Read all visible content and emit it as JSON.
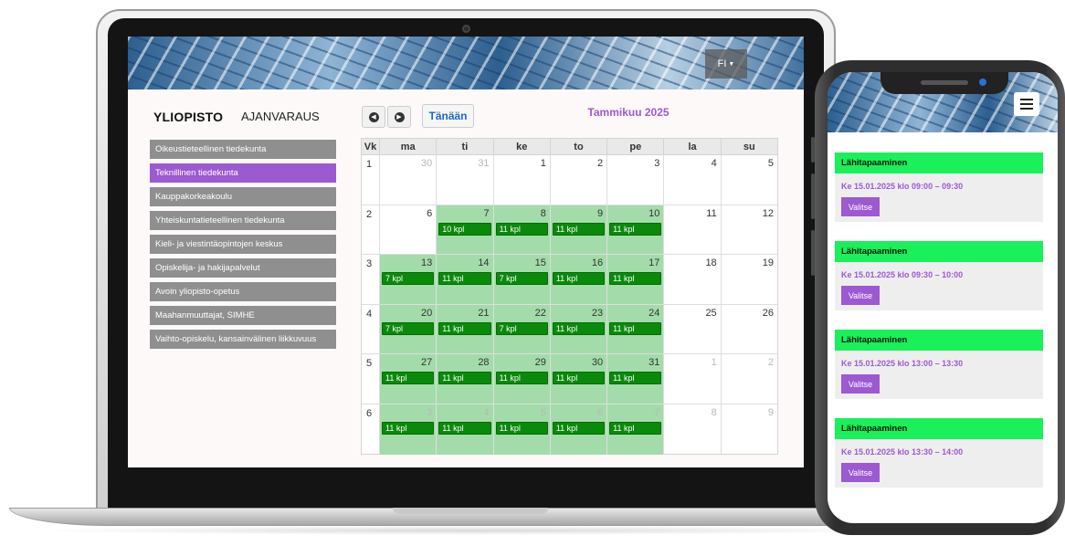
{
  "header": {
    "brand": "YLIOPISTO",
    "subtitle": "AJANVARAUS",
    "language": "FI"
  },
  "sidebar": {
    "items": [
      {
        "label": "Oikeustieteellinen tiedekunta",
        "active": false
      },
      {
        "label": "Teknillinen tiedekunta",
        "active": true
      },
      {
        "label": "Kauppakorkeakoulu",
        "active": false
      },
      {
        "label": "Yhteiskuntatieteellinen tiedekunta",
        "active": false
      },
      {
        "label": "Kieli- ja viestintäopintojen keskus",
        "active": false
      },
      {
        "label": "Opiskelija- ja hakijapalvelut",
        "active": false
      },
      {
        "label": "Avoin yliopisto-opetus",
        "active": false
      },
      {
        "label": "Maahanmuuttajat, SIMHE",
        "active": false
      },
      {
        "label": "Vaihto-opiskelu, kansainvälinen liikkuvuus",
        "active": false
      }
    ]
  },
  "calendar": {
    "prev_icon": "chevron-left-circle-icon",
    "next_icon": "chevron-right-circle-icon",
    "today_label": "Tänään",
    "month_title": "Tammikuu 2025",
    "headers": [
      "Vk",
      "ma",
      "ti",
      "ke",
      "to",
      "pe",
      "la",
      "su"
    ],
    "colors": {
      "available": "#a3dcaa",
      "slot": "#0a8a0a",
      "accent": "#9c59d1"
    },
    "weeks": [
      {
        "wk": "1",
        "days": [
          {
            "n": "30",
            "other": true,
            "green": false,
            "slot": ""
          },
          {
            "n": "31",
            "other": true,
            "green": false,
            "slot": ""
          },
          {
            "n": "1",
            "other": false,
            "green": false,
            "slot": ""
          },
          {
            "n": "2",
            "other": false,
            "green": false,
            "slot": ""
          },
          {
            "n": "3",
            "other": false,
            "green": false,
            "slot": ""
          },
          {
            "n": "4",
            "other": false,
            "green": false,
            "slot": ""
          },
          {
            "n": "5",
            "other": false,
            "green": false,
            "slot": ""
          }
        ]
      },
      {
        "wk": "2",
        "days": [
          {
            "n": "6",
            "other": false,
            "green": false,
            "slot": ""
          },
          {
            "n": "7",
            "other": false,
            "green": true,
            "slot": "10 kpl"
          },
          {
            "n": "8",
            "other": false,
            "green": true,
            "slot": "11 kpl"
          },
          {
            "n": "9",
            "other": false,
            "green": true,
            "slot": "11 kpl"
          },
          {
            "n": "10",
            "other": false,
            "green": true,
            "slot": "11 kpl"
          },
          {
            "n": "11",
            "other": false,
            "green": false,
            "slot": ""
          },
          {
            "n": "12",
            "other": false,
            "green": false,
            "slot": ""
          }
        ]
      },
      {
        "wk": "3",
        "days": [
          {
            "n": "13",
            "other": false,
            "green": true,
            "slot": "7 kpl"
          },
          {
            "n": "14",
            "other": false,
            "green": true,
            "slot": "11 kpl"
          },
          {
            "n": "15",
            "other": false,
            "green": true,
            "slot": "7 kpl"
          },
          {
            "n": "16",
            "other": false,
            "green": true,
            "slot": "11 kpl"
          },
          {
            "n": "17",
            "other": false,
            "green": true,
            "slot": "11 kpl"
          },
          {
            "n": "18",
            "other": false,
            "green": false,
            "slot": ""
          },
          {
            "n": "19",
            "other": false,
            "green": false,
            "slot": ""
          }
        ]
      },
      {
        "wk": "4",
        "days": [
          {
            "n": "20",
            "other": false,
            "green": true,
            "slot": "7 kpl"
          },
          {
            "n": "21",
            "other": false,
            "green": true,
            "slot": "11 kpl"
          },
          {
            "n": "22",
            "other": false,
            "green": true,
            "slot": "7 kpl"
          },
          {
            "n": "23",
            "other": false,
            "green": true,
            "slot": "11 kpl"
          },
          {
            "n": "24",
            "other": false,
            "green": true,
            "slot": "11 kpl"
          },
          {
            "n": "25",
            "other": false,
            "green": false,
            "slot": ""
          },
          {
            "n": "26",
            "other": false,
            "green": false,
            "slot": ""
          }
        ]
      },
      {
        "wk": "5",
        "days": [
          {
            "n": "27",
            "other": false,
            "green": true,
            "slot": "11 kpl"
          },
          {
            "n": "28",
            "other": false,
            "green": true,
            "slot": "11 kpl"
          },
          {
            "n": "29",
            "other": false,
            "green": true,
            "slot": "11 kpl"
          },
          {
            "n": "30",
            "other": false,
            "green": true,
            "slot": "11 kpl"
          },
          {
            "n": "31",
            "other": false,
            "green": true,
            "slot": "11 kpl"
          },
          {
            "n": "1",
            "other": true,
            "green": false,
            "slot": ""
          },
          {
            "n": "2",
            "other": true,
            "green": false,
            "slot": ""
          }
        ]
      },
      {
        "wk": "6",
        "days": [
          {
            "n": "3",
            "other": true,
            "green": true,
            "slot": "11 kpl"
          },
          {
            "n": "4",
            "other": true,
            "green": true,
            "slot": "11 kpl"
          },
          {
            "n": "5",
            "other": true,
            "green": true,
            "slot": "11 kpl"
          },
          {
            "n": "6",
            "other": true,
            "green": true,
            "slot": "11 kpl"
          },
          {
            "n": "7",
            "other": true,
            "green": true,
            "slot": "11 kpl"
          },
          {
            "n": "8",
            "other": true,
            "green": false,
            "slot": ""
          },
          {
            "n": "9",
            "other": true,
            "green": false,
            "slot": ""
          }
        ]
      }
    ]
  },
  "mobile": {
    "menu_icon": "hamburger-menu-icon",
    "appointments": [
      {
        "title": "Lähitapaaminen",
        "time": "Ke 15.01.2025 klo 09:00 – 09:30",
        "button": "Valitse"
      },
      {
        "title": "Lähitapaaminen",
        "time": "Ke 15.01.2025 klo 09:30 – 10:00",
        "button": "Valitse"
      },
      {
        "title": "Lähitapaaminen",
        "time": "Ke 15.01.2025 klo 13:00 – 13:30",
        "button": "Valitse"
      },
      {
        "title": "Lähitapaaminen",
        "time": "Ke 15.01.2025 klo 13:30 – 14:00",
        "button": "Valitse"
      }
    ]
  }
}
